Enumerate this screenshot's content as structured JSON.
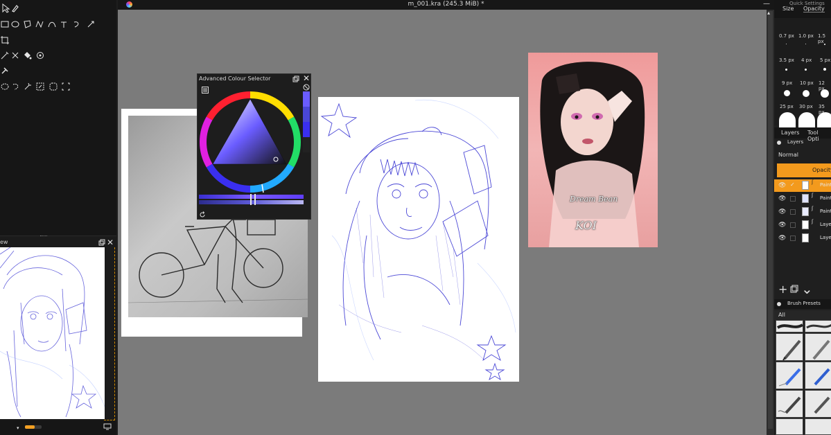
{
  "window": {
    "title": "m_001.kra (245.3 MiB) *"
  },
  "overview": {
    "title": "ew"
  },
  "color_selector": {
    "title": "Advanced Colour Selector"
  },
  "right_dock": {
    "quick_settings_title": "Quick Settings",
    "tabs": {
      "size": "Size",
      "opacity": "Opacity"
    },
    "brush_sizes": [
      {
        "label": "0.7 px"
      },
      {
        "label": "1.0 px"
      },
      {
        "label": "1.5 px"
      },
      {
        "label": "3.5 px"
      },
      {
        "label": "4 px"
      },
      {
        "label": "5 px"
      },
      {
        "label": "9 px"
      },
      {
        "label": "10 px"
      },
      {
        "label": "12 px"
      },
      {
        "label": "25 px"
      },
      {
        "label": "30 px"
      },
      {
        "label": "35 px"
      }
    ],
    "layers_tabs": {
      "layers": "Layers",
      "tool_options": "Tool Opti"
    },
    "layers_title": "Layers",
    "blend_mode": "Normal",
    "opacity_label": "Opacity",
    "layers": [
      {
        "name": "Paint",
        "selected": true
      },
      {
        "name": "Paint",
        "selected": false
      },
      {
        "name": "Paint",
        "selected": false
      },
      {
        "name": "Layer",
        "selected": false
      },
      {
        "name": "Layer",
        "selected": false
      }
    ],
    "brush_presets_title": "Brush Presets",
    "brush_filter": "All"
  },
  "canvas": {
    "koi_caption_line1": "Dream Bean",
    "koi_caption_line2": "KOI"
  },
  "colors": {
    "accent": "#f39a1d",
    "canvas_bg": "#7b7b7b",
    "sketch_ink": "#4a47d6"
  }
}
